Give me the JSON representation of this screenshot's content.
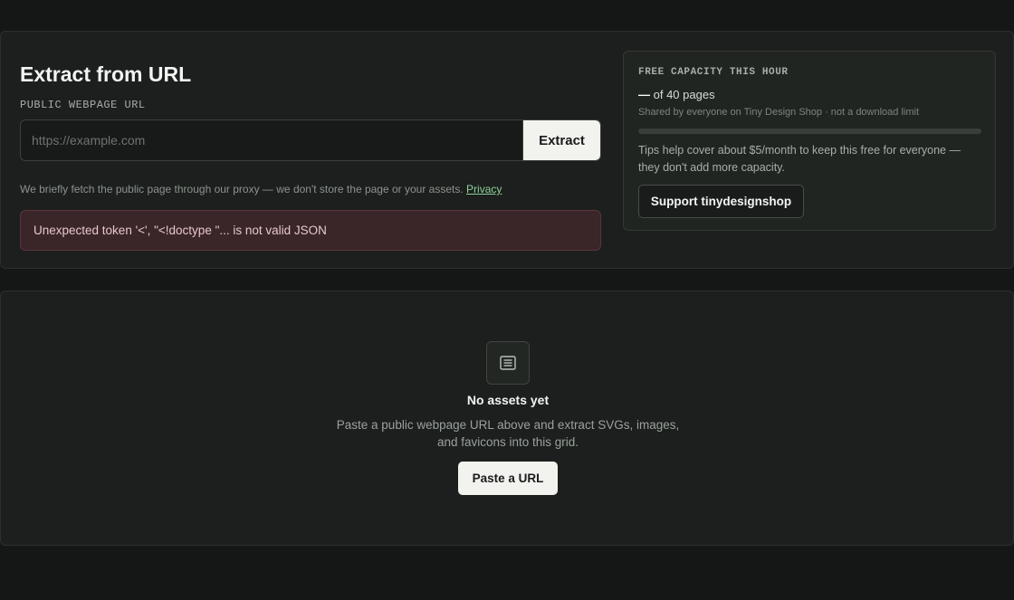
{
  "extract": {
    "title": "Extract from URL",
    "field_label": "PUBLIC WEBPAGE URL",
    "url_placeholder": "https://example.com",
    "url_value": "",
    "extract_label": "Extract",
    "note_text": "We briefly fetch the public page through our proxy — we don't store the page or your assets.",
    "privacy_label": "Privacy",
    "error_text": "Unexpected token '<', \"<!doctype \"... is not valid JSON"
  },
  "capacity": {
    "heading": "FREE CAPACITY THIS HOUR",
    "used": "—",
    "total_text": "of 40 pages",
    "shared_text": "Shared by everyone on Tiny Design Shop · not a download limit",
    "usage_fraction": 0,
    "tips_text": "Tips help cover about $5/month to keep this free for everyone — they don't add more capacity.",
    "support_label": "Support tinydesignshop"
  },
  "assets": {
    "empty_icon": "document-icon",
    "empty_title": "No assets yet",
    "empty_desc": "Paste a public webpage URL above and extract SVGs, images, and favicons into this grid.",
    "paste_label": "Paste a URL"
  },
  "colors": {
    "background": "#151716",
    "panel": "#1c1f1d",
    "accent_link": "#8fcf9a",
    "error_bg": "#3a2529",
    "error_text": "#e6c9cd",
    "primary_button": "#f2f2ef"
  }
}
